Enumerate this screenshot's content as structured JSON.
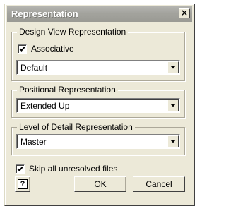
{
  "window": {
    "title": "Representation",
    "close_label": "×"
  },
  "design_view": {
    "label": "Design View Representation",
    "associative_label": "Associative",
    "associative_checked": true,
    "value": "Default"
  },
  "positional": {
    "label": "Positional Representation",
    "value": "Extended Up"
  },
  "level_of_detail": {
    "label": "Level of Detail Representation",
    "value": "Master"
  },
  "skip_unresolved": {
    "label": "Skip all unresolved files",
    "checked": true
  },
  "buttons": {
    "help_label": "?",
    "ok_label": "OK",
    "cancel_label": "Cancel"
  }
}
